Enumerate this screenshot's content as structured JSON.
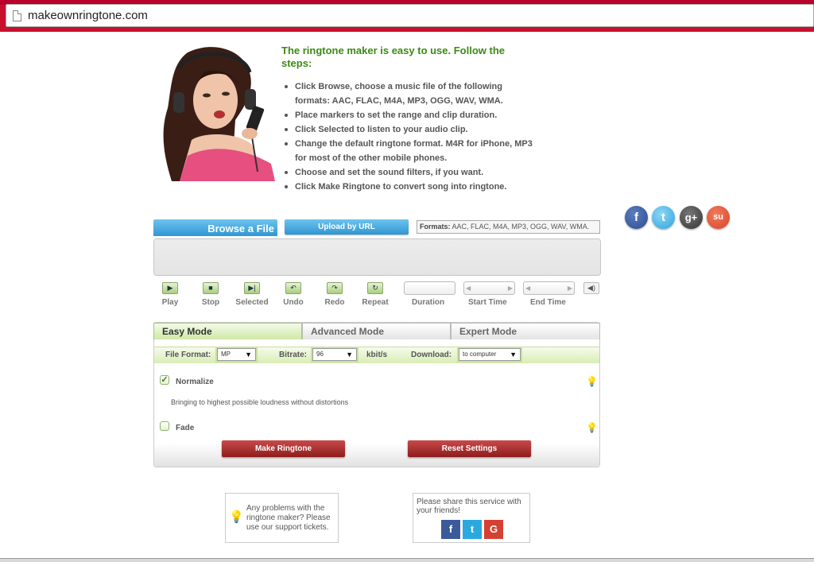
{
  "browser": {
    "url": "makeownringtone.com"
  },
  "intro": {
    "title": "The ringtone maker is easy to use. Follow the steps:",
    "steps": [
      "Click Browse, choose a music file of the following formats: AAC, FLAC, M4A, MP3, OGG, WAV, WMA.",
      "Place markers to set the range and clip duration.",
      "Click Selected to listen to your audio clip.",
      "Change the default ringtone format. M4R for iPhone, MP3 for most of the other mobile phones.",
      "Choose and set the sound filters, if you want.",
      "Click Make Ringtone to convert song into ringtone."
    ]
  },
  "social": {
    "fb": "f",
    "tw": "t",
    "gp": "g+",
    "su": "su"
  },
  "upload": {
    "browse_label": "Browse a File",
    "url_label": "Upload by URL",
    "formats_label": "Formats:",
    "formats_value": "AAC, FLAC, M4A, MP3, OGG, WAV, WMA."
  },
  "controls": {
    "play": "Play",
    "stop": "Stop",
    "selected": "Selected",
    "undo": "Undo",
    "redo": "Redo",
    "repeat": "Repeat",
    "duration": "Duration",
    "start_time": "Start Time",
    "end_time": "End Time"
  },
  "modes": {
    "tabs": [
      "Easy Mode",
      "Advanced Mode",
      "Expert Mode"
    ],
    "file_format_label": "File Format:",
    "file_format_value": "MP",
    "bitrate_label": "Bitrate:",
    "bitrate_value": "96",
    "bitrate_unit": "kbit/s",
    "download_label": "Download:",
    "download_value": "to computer",
    "normalize_label": "Normalize",
    "normalize_checked": true,
    "normalize_desc": "Bringing to highest possible loudness without distortions",
    "fade_label": "Fade",
    "fade_checked": false,
    "make_label": "Make Ringtone",
    "reset_label": "Reset Settings"
  },
  "footer": {
    "help_text": "Any problems with the ringtone maker? Please use our support tickets.",
    "share_text": "Please share this service with your friends!",
    "share_fb": "f",
    "share_tw": "t",
    "share_gp": "G"
  },
  "colors": {
    "browser_bar": "#c8102e",
    "title_green": "#3b8a14",
    "blue_button": "#2f97d4",
    "red_button": "#8e1c1c",
    "tab_green": "#cfe8a5"
  }
}
